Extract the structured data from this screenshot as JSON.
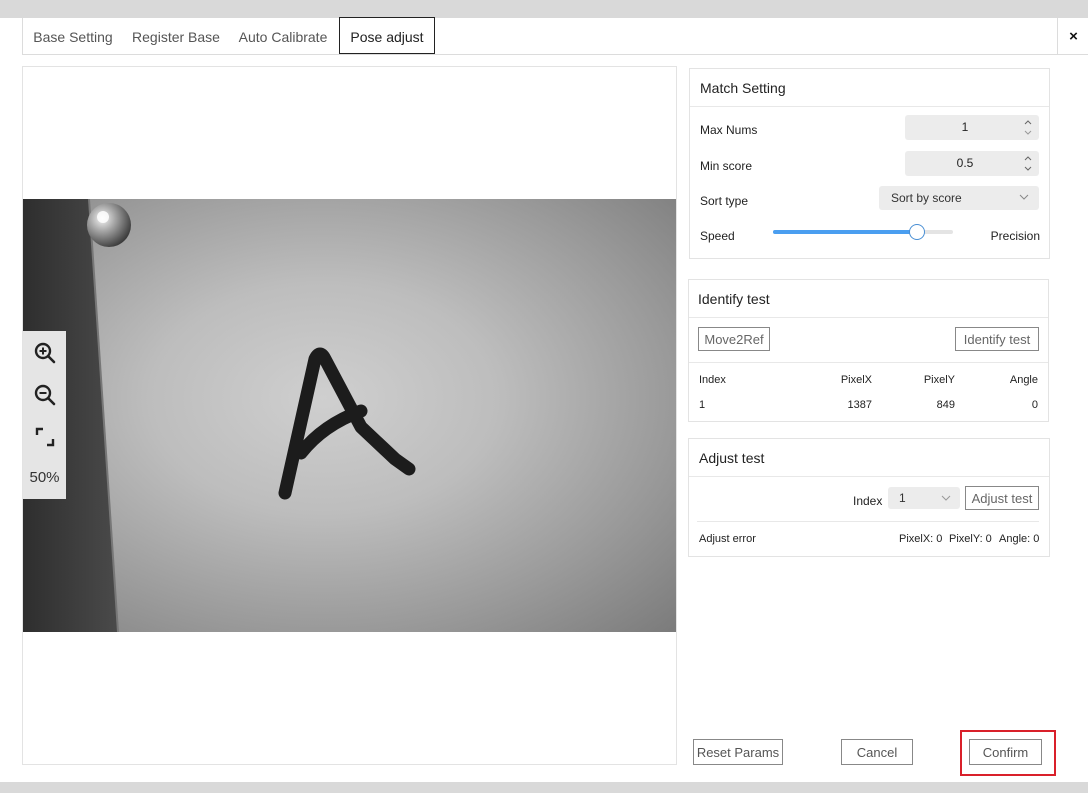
{
  "tabs": [
    {
      "label": "Base Setting"
    },
    {
      "label": "Register Base"
    },
    {
      "label": "Auto Calibrate"
    },
    {
      "label": "Pose adjust"
    }
  ],
  "close_icon": "×",
  "viewer": {
    "zoom_level": "50%",
    "icons": [
      "zoom-in-icon",
      "zoom-out-icon",
      "fit-screen-icon"
    ]
  },
  "match_setting": {
    "title": "Match Setting",
    "max_nums_label": "Max Nums",
    "max_nums_value": "1",
    "min_score_label": "Min score",
    "min_score_value": "0.5",
    "sort_type_label": "Sort type",
    "sort_type_value": "Sort by score",
    "speed_label": "Speed",
    "precision_label": "Precision",
    "speed_precision_slider": 0.8
  },
  "identify_test": {
    "title": "Identify test",
    "move2ref_label": "Move2Ref",
    "identify_label": "Identify test",
    "columns": [
      "Index",
      "PixelX",
      "PixelY",
      "Angle"
    ],
    "rows": [
      [
        "1",
        "1387",
        "849",
        "0"
      ]
    ]
  },
  "adjust_test": {
    "title": "Adjust test",
    "index_label": "Index",
    "index_value": "1",
    "adjust_button_label": "Adjust test",
    "error_label": "Adjust error",
    "pixelx_text": "PixelX: 0",
    "pixely_text": "PixelY: 0",
    "angle_text": "Angle: 0"
  },
  "footer": {
    "reset_label": "Reset Params",
    "cancel_label": "Cancel",
    "confirm_label": "Confirm"
  },
  "colors": {
    "accent": "#4a9ef0",
    "highlight": "#d9202a"
  }
}
